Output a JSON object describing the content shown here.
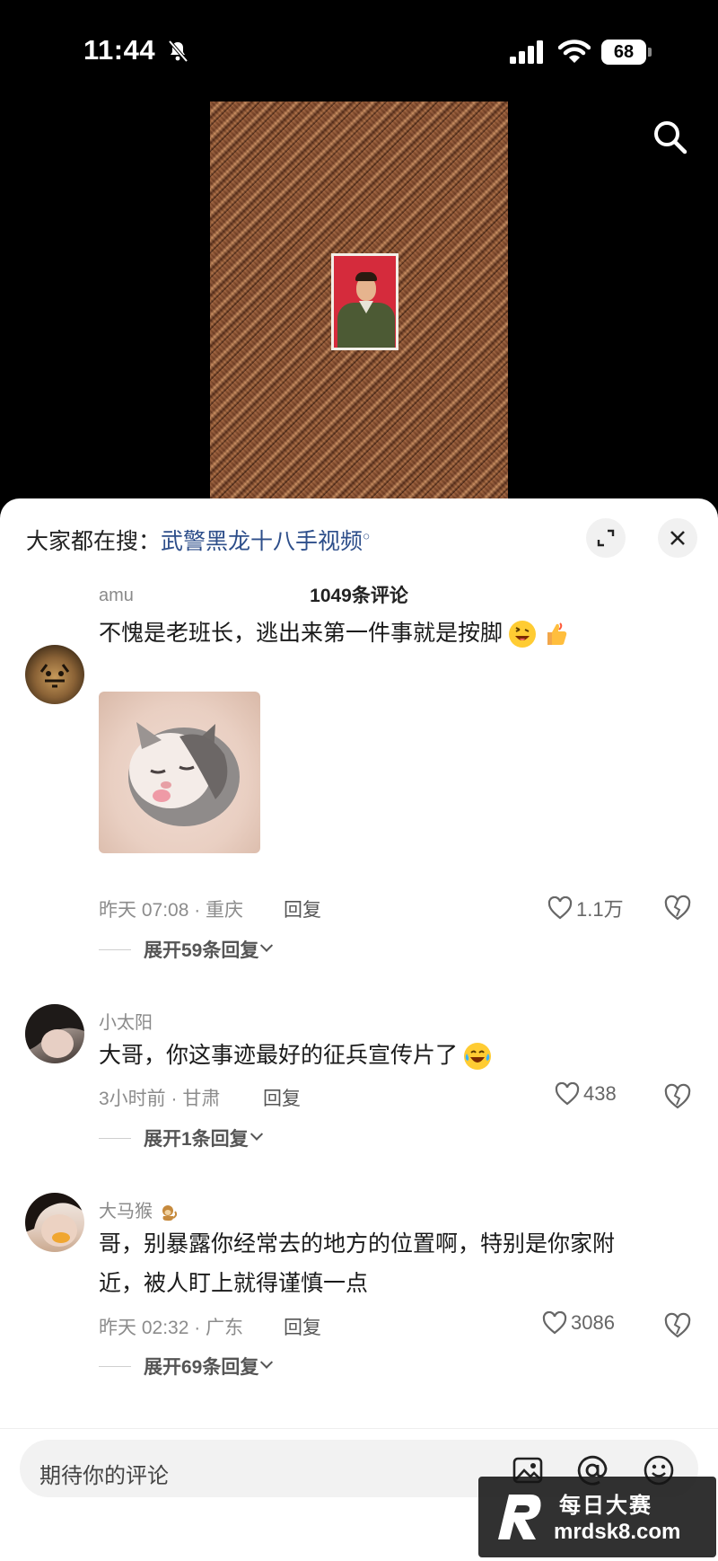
{
  "status_bar": {
    "time": "11:44",
    "battery": "68"
  },
  "sheet": {
    "suggest_prefix": "大家都在搜：",
    "suggest_query": "武警黑龙十八手视频",
    "comment_count": "1049条评论"
  },
  "comments": [
    {
      "username": "amu",
      "text": "不愧是老班长，逃出来第一件事就是按脚",
      "emojis": [
        "grinning-wink-emoji",
        "thumbs-up-emoji"
      ],
      "has_image": true,
      "time_location": "昨天 07:08 · 重庆",
      "reply_label": "回复",
      "likes": "1.1万",
      "expand_label": "展开59条回复"
    },
    {
      "username": "小太阳",
      "text": "大哥，你这事迹最好的征兵宣传片了",
      "emojis": [
        "laugh-cry-emoji"
      ],
      "has_image": false,
      "time_location": "3小时前 · 甘肃",
      "reply_label": "回复",
      "likes": "438",
      "expand_label": "展开1条回复"
    },
    {
      "username": "大马猴",
      "text": "哥，别暴露你经常去的地方的位置啊，特别是你家附近，被人盯上就得谨慎一点",
      "emojis": [],
      "has_image": false,
      "time_location": "昨天 02:32 · 广东",
      "reply_label": "回复",
      "likes": "3086",
      "expand_label": "展开69条回复"
    }
  ],
  "input_bar": {
    "placeholder": "期待你的评论"
  },
  "watermark": {
    "top": "每日大赛",
    "bottom": "mrdsk8.com"
  },
  "colors": {
    "link": "#2d4e8a",
    "background_top": "#000000",
    "sheet": "#ffffff"
  }
}
